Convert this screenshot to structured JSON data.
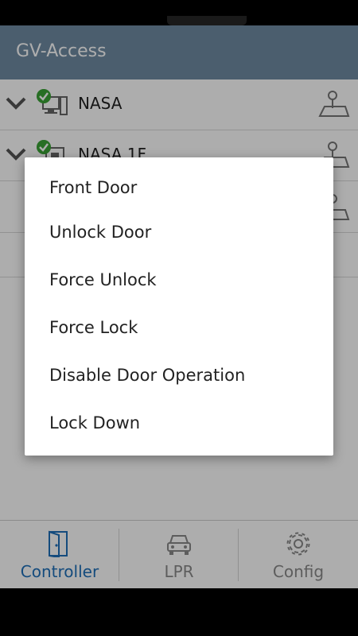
{
  "app": {
    "title": "GV-Access"
  },
  "controllers": [
    {
      "name": "NASA",
      "status": "online"
    },
    {
      "name": "NASA 1F",
      "status": "online"
    }
  ],
  "tabs": [
    {
      "label": "Controller",
      "icon": "door-icon",
      "active": true
    },
    {
      "label": "LPR",
      "icon": "car-icon",
      "active": false
    },
    {
      "label": "Config",
      "icon": "gear-icon",
      "active": false
    }
  ],
  "dialog": {
    "title": "Front Door",
    "items": [
      {
        "label": "Unlock Door"
      },
      {
        "label": "Force Unlock"
      },
      {
        "label": "Force Lock"
      },
      {
        "label": "Disable Door Operation"
      },
      {
        "label": "Lock Down"
      }
    ]
  },
  "colors": {
    "appbar": "#6f8ba3",
    "accent": "#1e6fb8",
    "online": "#3aa335"
  }
}
